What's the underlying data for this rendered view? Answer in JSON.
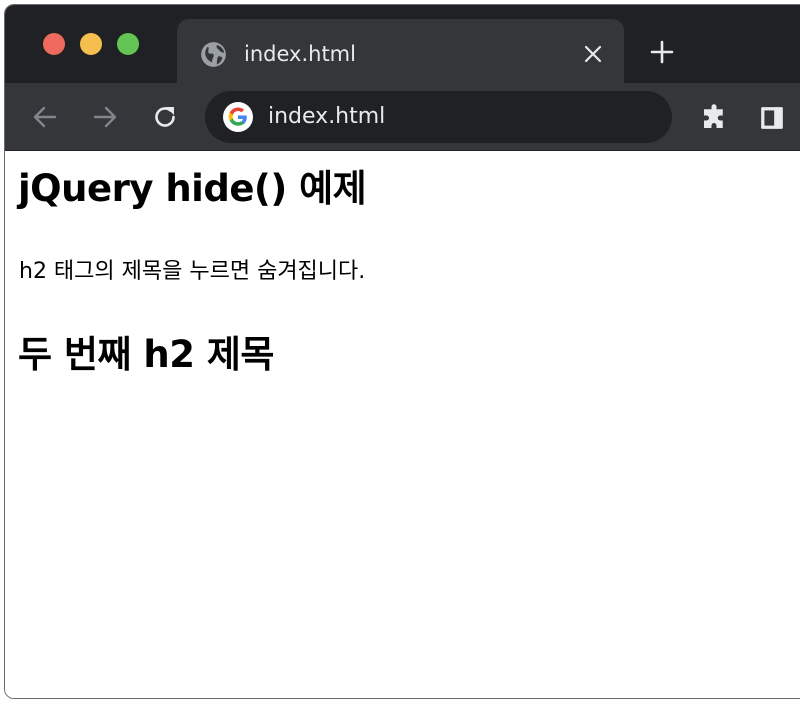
{
  "browser": {
    "tab": {
      "title": "index.html"
    },
    "address_bar": {
      "value": "index.html"
    },
    "icons": {
      "window_close": "red-dot",
      "window_minimize": "yellow-dot",
      "window_zoom": "green-dot",
      "tab_favicon": "globe-icon",
      "tab_close": "close-icon",
      "new_tab": "plus-icon",
      "back": "arrow-left-icon",
      "forward": "arrow-right-icon",
      "reload": "reload-icon",
      "omnibox": "google-g-icon",
      "extensions": "puzzle-icon",
      "side_panel": "side-panel-icon"
    },
    "colors": {
      "traffic_red": "#ee6a5f",
      "traffic_yellow": "#f5be4f",
      "traffic_green": "#62c554",
      "tabstrip": "#202124",
      "toolbar": "#35363a",
      "omnibox": "#202124"
    }
  },
  "page": {
    "heading_1": "jQuery hide() 예제",
    "paragraph": "h2 태그의 제목을 누르면 숨겨집니다.",
    "heading_2": "두 번째 h2 제목"
  }
}
